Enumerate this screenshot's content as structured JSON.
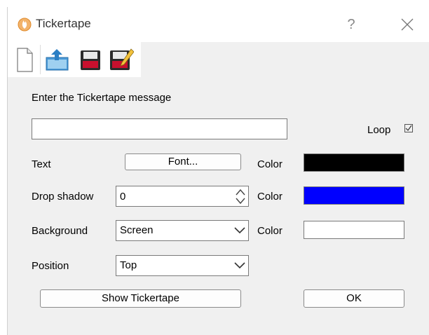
{
  "window": {
    "title": "Tickertape",
    "help_glyph": "?"
  },
  "toolbar": {
    "icons": [
      "new-document-icon",
      "open-icon",
      "save-icon",
      "save-as-icon"
    ]
  },
  "form": {
    "prompt": "Enter the Tickertape message",
    "message_value": "",
    "loop_label": "Loop",
    "loop_checked": true,
    "text_label": "Text",
    "font_button": "Font...",
    "text_color_label": "Color",
    "text_color": "#000000",
    "drop_shadow_label": "Drop shadow",
    "drop_shadow_value": "0",
    "shadow_color_label": "Color",
    "shadow_color": "#0000ff",
    "background_label": "Background",
    "background_value": "Screen",
    "background_color_label": "Color",
    "background_color": "#ffffff",
    "position_label": "Position",
    "position_value": "Top",
    "show_button": "Show Tickertape",
    "ok_button": "OK"
  }
}
